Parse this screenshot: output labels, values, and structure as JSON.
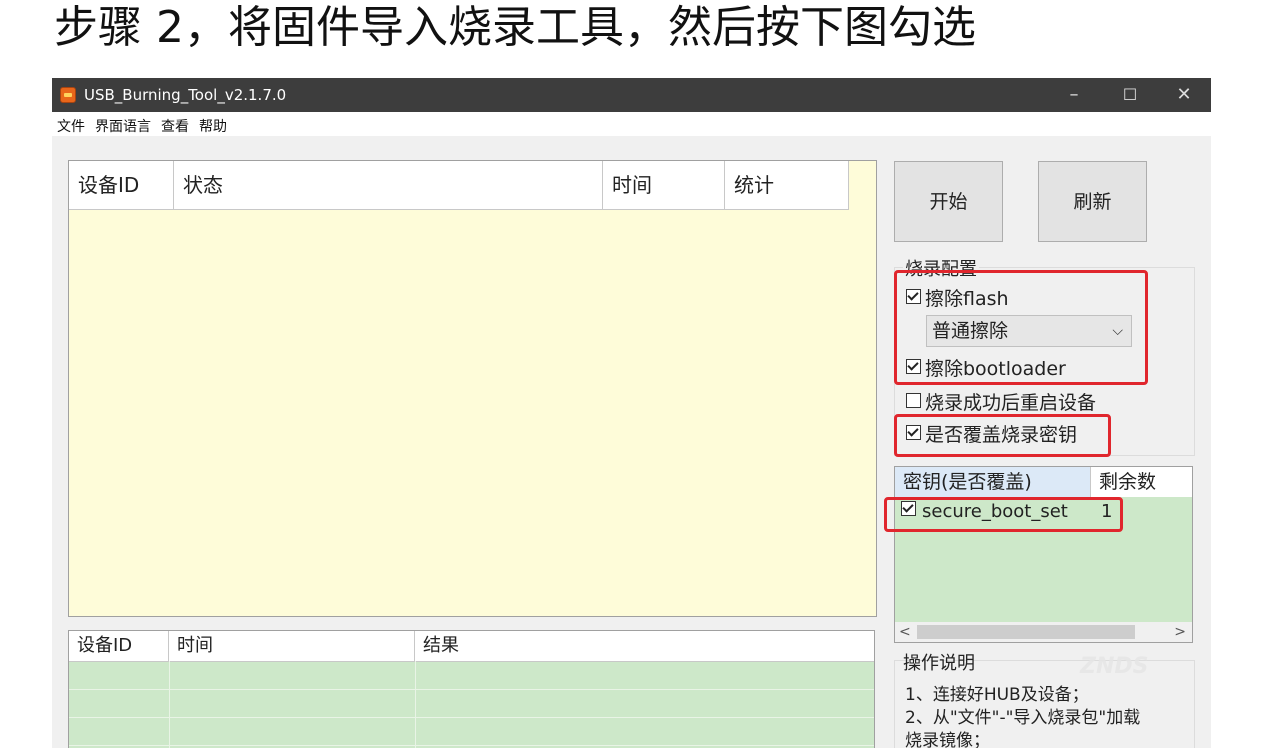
{
  "heading": "步骤 2，将固件导入烧录工具，然后按下图勾选",
  "window": {
    "title": "USB_Burning_Tool_v2.1.7.0",
    "controls": {
      "minimize": "–",
      "maximize": "☐",
      "close": "✕"
    }
  },
  "menu": [
    "文件",
    "界面语言",
    "查看",
    "帮助"
  ],
  "device_grid": {
    "columns": [
      "设备ID",
      "状态",
      "时间",
      "统计"
    ]
  },
  "buttons": {
    "start": "开始",
    "refresh": "刷新"
  },
  "burn_config": {
    "title": "烧录配置",
    "erase_flash": {
      "label": "擦除flash",
      "checked": true
    },
    "erase_mode": "普通擦除",
    "erase_bootloader": {
      "label": "擦除bootloader",
      "checked": true
    },
    "reboot_after": {
      "label": "烧录成功后重启设备",
      "checked": false
    },
    "overwrite_key": {
      "label": "是否覆盖烧录密钥",
      "checked": true
    }
  },
  "key_list": {
    "columns": [
      "密钥(是否覆盖)",
      "剩余数"
    ],
    "rows": [
      {
        "name": "secure_boot_set",
        "remaining": "1",
        "checked": true
      }
    ]
  },
  "operation": {
    "title": "操作说明",
    "lines": [
      "1、连接好HUB及设备；",
      "2、从\"文件\"-\"导入烧录包\"加载",
      "烧录镜像；"
    ]
  },
  "result_grid": {
    "columns": [
      "设备ID",
      "时间",
      "结果"
    ]
  },
  "watermark": "ZNDS",
  "colors": {
    "highlight": "#e0262d",
    "grid_yellow": "#fefcd9",
    "grid_green": "#cde8c9",
    "titlebar": "#3d3d3d"
  }
}
